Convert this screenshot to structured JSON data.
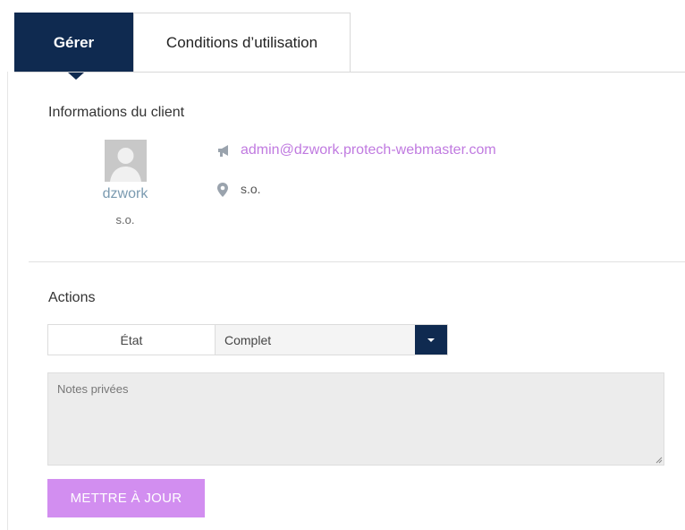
{
  "tabs": {
    "manage_label": "Gérer",
    "terms_label": "Conditions d’utilisation"
  },
  "client_info": {
    "title": "Informations du client",
    "username": "dzwork",
    "user_meta": "s.o.",
    "email": "admin@dzwork.protech-webmaster.com",
    "location": "s.o.",
    "email_icon": "megaphone-icon",
    "location_icon": "map-pin-icon"
  },
  "actions": {
    "title": "Actions",
    "status_label": "État",
    "status_value": "Complet",
    "notes_placeholder": "Notes privées",
    "update_button_label": "METTRE À JOUR"
  },
  "colors": {
    "primary_navy": "#0f2a50",
    "link_purple": "#c07ae0",
    "button_purple": "#d28ef0",
    "username_blue": "#7a9ab0"
  }
}
